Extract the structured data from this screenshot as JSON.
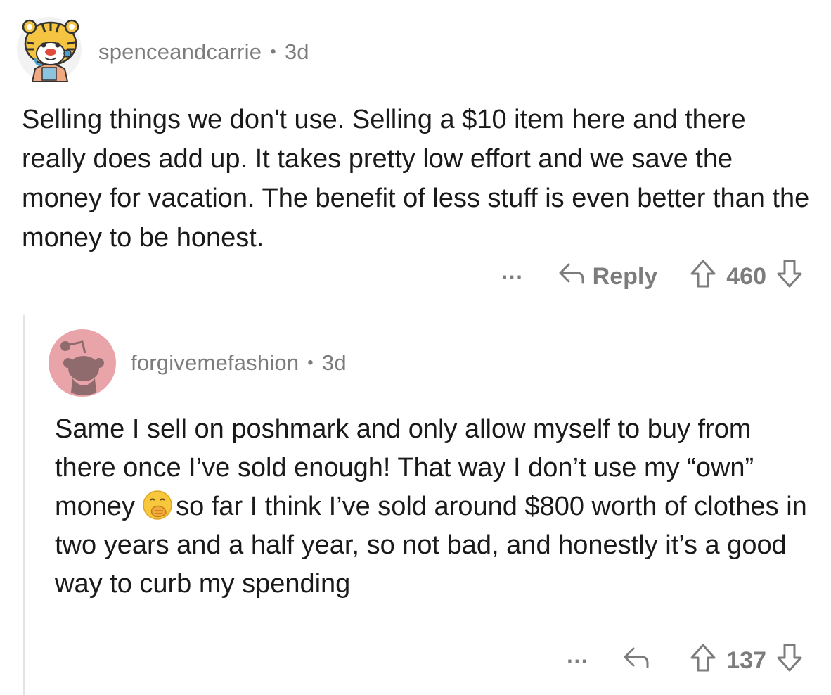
{
  "comments": [
    {
      "username": "spenceandcarrie",
      "separator": "•",
      "age": "3d",
      "avatar": "tiger-snoo-avatar-icon",
      "body": "Selling things we don't use. Selling a $10 item here and there really does add up.  It takes pretty low effort and we save the money for vacation.  The benefit of less stuff is even better than the money to be honest.",
      "more_label": "...",
      "reply_label": "Reply",
      "votes": "460"
    },
    {
      "username": "forgivemefashion",
      "separator": "•",
      "age": "3d",
      "avatar": "default-snoo-avatar-icon",
      "body_part1": "Same I sell on poshmark and only allow myself to buy from there once I’ve sold enough! That way I don’t use my “own” money",
      "emoji": "face-with-hand-over-mouth-emoji",
      "body_part2": "so far I think I’ve sold around $800 worth of clothes in two years and a half year, so not bad, and honestly it’s a good way to curb my spending",
      "more_label": "...",
      "votes": "137"
    }
  ],
  "colors": {
    "meta_text": "#7c7c7c",
    "body_text": "#1a1a1b",
    "thread_line": "#e4e4e4",
    "avatar2_bg": "#e8a4a9",
    "avatar2_fg": "#8f6b6e"
  }
}
